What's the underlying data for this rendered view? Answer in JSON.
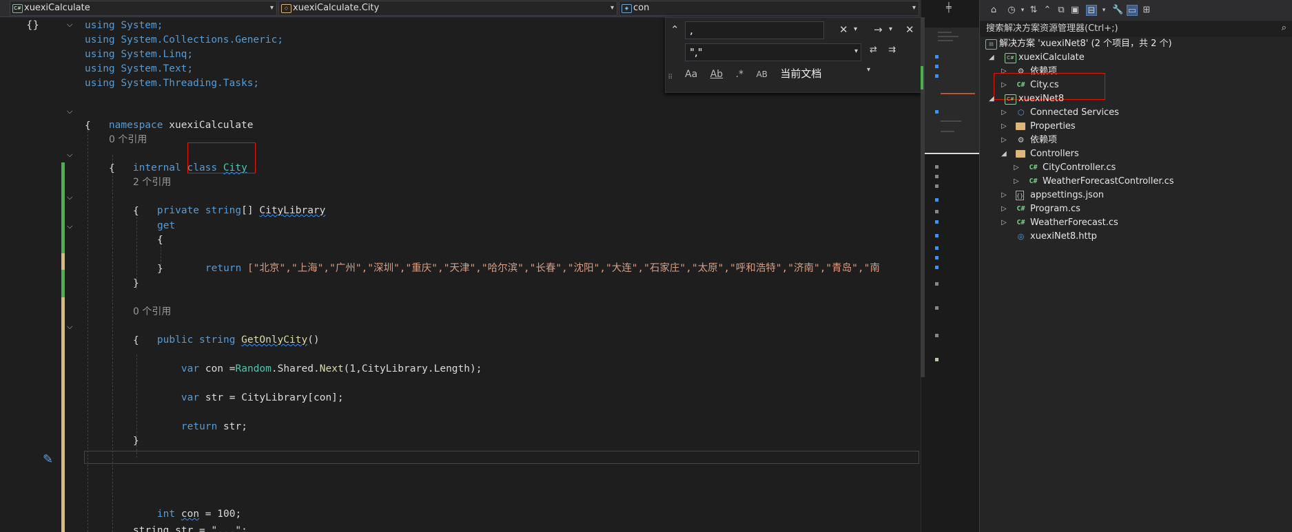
{
  "navbar": {
    "project": "xuexiCalculate",
    "type": "xuexiCalculate.City",
    "member": "con"
  },
  "code": {
    "usings": [
      "using System;",
      "using System.Collections.Generic;",
      "using System.Linq;",
      "using System.Text;",
      "using System.Threading.Tasks;"
    ],
    "namespace_kw": "namespace",
    "namespace_name": "xuexiCalculate",
    "open_brace": "{",
    "close_brace": "}",
    "refs_class": "0 个引用",
    "class_mods": "internal class",
    "class_name": "City",
    "refs_prop": "2 个引用",
    "prop_kw1": "private",
    "prop_kw2": "string",
    "prop_brackets": "[]",
    "prop_name": "CityLibrary",
    "get_kw": "get",
    "return_kw": "return",
    "return_array": "[\"北京\",\"上海\",\"广州\",\"深圳\",\"重庆\",\"天津\",\"哈尔滨\",\"长春\",\"沈阳\",\"大连\",\"石家庄\",\"太原\",\"呼和浩特\",\"济南\",\"青岛\",\"南",
    "refs_method": "0 个引用",
    "method_kw1": "public",
    "method_kw2": "string",
    "method_name": "GetOnlyCity",
    "method_parens": "()",
    "var_kw": "var",
    "line_con_a": "con =",
    "line_con_type": "Random",
    "line_con_b": ".Shared.",
    "line_con_fn": "Next",
    "line_con_c": "(1,CityLibrary.Length);",
    "line_str": "str = CityLibrary[con];",
    "line_return": "str;",
    "int_kw": "int",
    "int_name": "con",
    "int_rest": "= 100;",
    "last_line": "string str = \"...\";"
  },
  "find": {
    "find_value": ",",
    "replace_value": "\",\"",
    "scope": "当前文档",
    "opt_case": "Aa",
    "opt_word": "Ab",
    "opt_regex": ".*",
    "opt_preserve": "AB"
  },
  "solution_explorer": {
    "search_placeholder": "搜索解决方案资源管理器(Ctrl+;)",
    "solution": "解决方案 'xuexiNet8' (2 个项目，共 2 个)",
    "items": [
      {
        "label": "xuexiCalculate"
      },
      {
        "label": "依赖项"
      },
      {
        "label": "City.cs"
      },
      {
        "label": "xuexiNet8"
      },
      {
        "label": "Connected Services"
      },
      {
        "label": "Properties"
      },
      {
        "label": "依赖项"
      },
      {
        "label": "Controllers"
      },
      {
        "label": "CityController.cs"
      },
      {
        "label": "WeatherForecastController.cs"
      },
      {
        "label": "appsettings.json"
      },
      {
        "label": "Program.cs"
      },
      {
        "label": "WeatherForecast.cs"
      },
      {
        "label": "xuexiNet8.http"
      }
    ]
  },
  "colors": {
    "keyword": "#569cd6",
    "type": "#4ec9b0",
    "string": "#d69d85",
    "highlight_box": "#e51400",
    "change_bar": "#4caf50"
  }
}
